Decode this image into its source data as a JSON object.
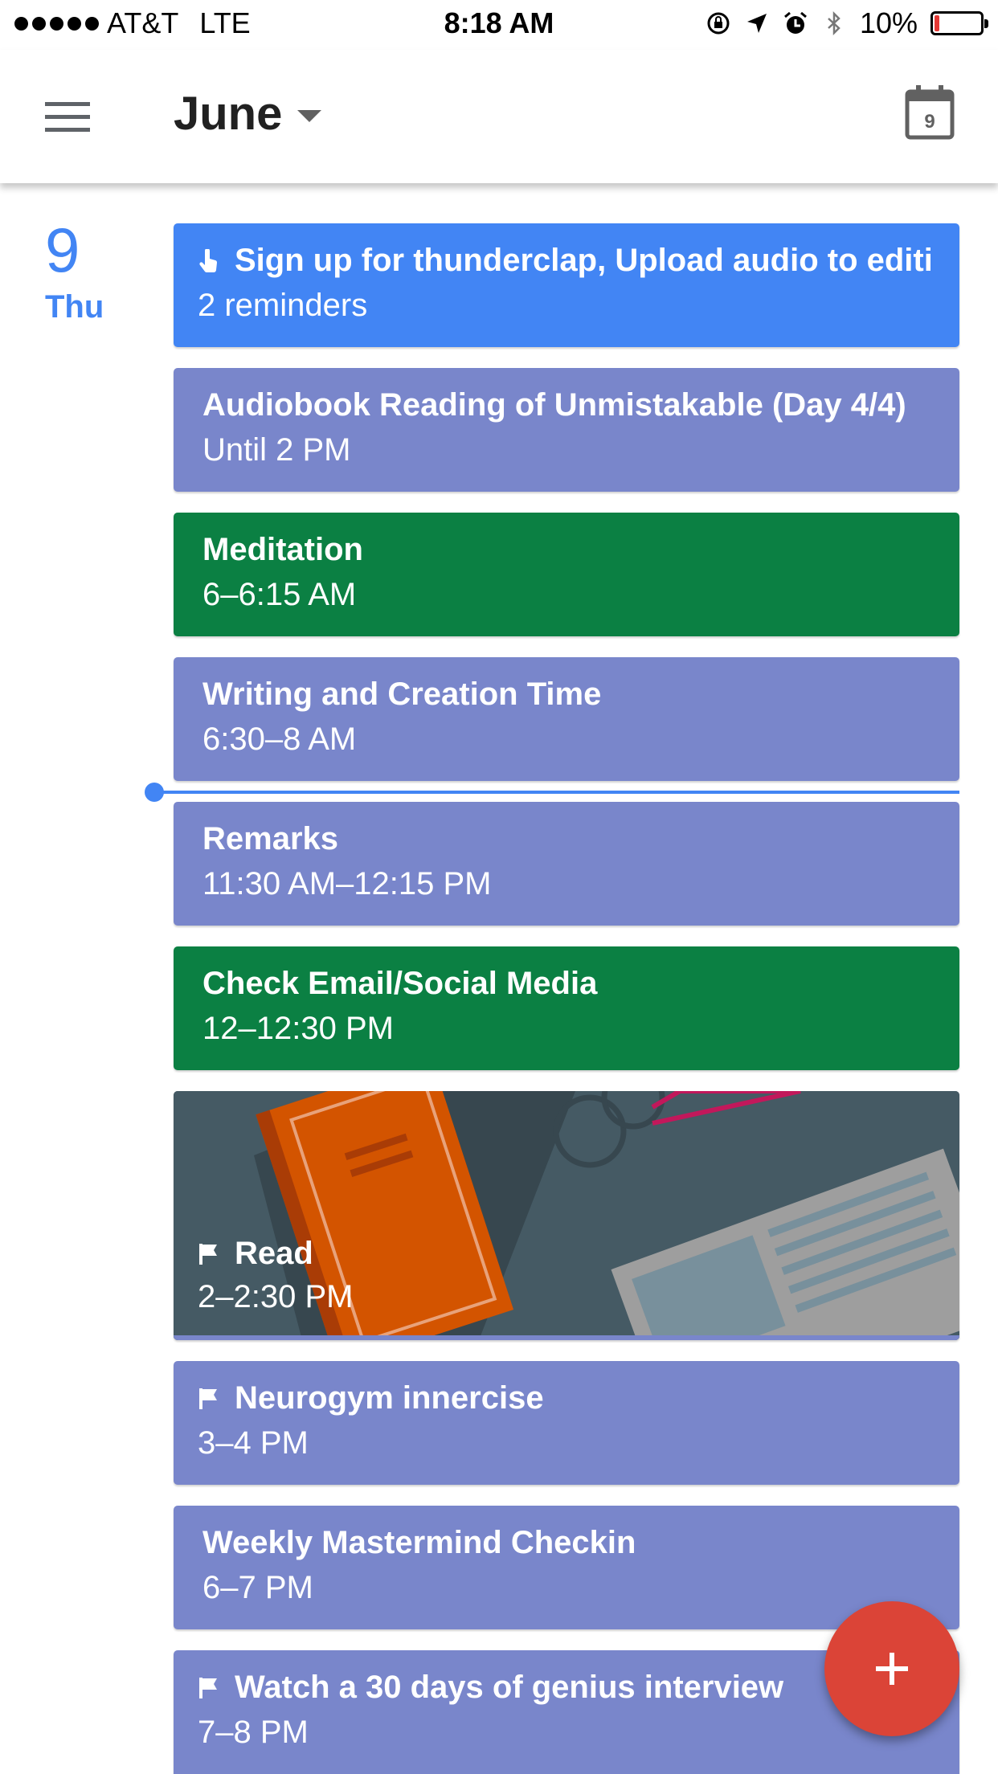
{
  "status_bar": {
    "carrier": "AT&T",
    "network": "LTE",
    "time": "8:18 AM",
    "battery": "10%",
    "battery_level": 0.1,
    "battery_color": "#e53935"
  },
  "app_bar": {
    "month": "June",
    "today_date": "9",
    "menu_icon": "hamburger-menu-icon",
    "today_icon": "calendar-today-icon"
  },
  "day": {
    "number": "9",
    "name": "Thu",
    "accent": "#4285f4"
  },
  "events": [
    {
      "title": "Sign up for thunderclap, Upload audio to editi",
      "time": "2 reminders",
      "color": "#4285f4",
      "icon": "reminder-hand-icon"
    },
    {
      "title": "Audiobook Reading of Unmistakable (Day 4/4)",
      "time": "Until 2 PM",
      "color": "#7986cb"
    },
    {
      "title": "Meditation",
      "time": "6–6:15 AM",
      "color": "#0b8043"
    },
    {
      "title": "Writing and Creation Time",
      "time": "6:30–8 AM",
      "color": "#7986cb"
    },
    {
      "title": "Remarks",
      "time": "11:30 AM–12:15 PM",
      "color": "#7986cb"
    },
    {
      "title": "Check Email/Social Media",
      "time": "12–12:30 PM",
      "color": "#0b8043"
    },
    {
      "title": "Read",
      "time": "2–2:30 PM",
      "color": "#455a64",
      "icon": "flag-icon",
      "illustration": "reading-illustration"
    },
    {
      "title": "Neurogym innercise",
      "time": "3–4 PM",
      "color": "#7986cb",
      "icon": "flag-icon"
    },
    {
      "title": "Weekly Mastermind Checkin",
      "time": "6–7 PM",
      "color": "#7986cb"
    },
    {
      "title": "Watch a 30 days of genius interview",
      "time": "7–8 PM",
      "color": "#7986cb",
      "icon": "flag-icon"
    }
  ],
  "fab": {
    "icon": "plus-icon",
    "color": "#db4437"
  }
}
